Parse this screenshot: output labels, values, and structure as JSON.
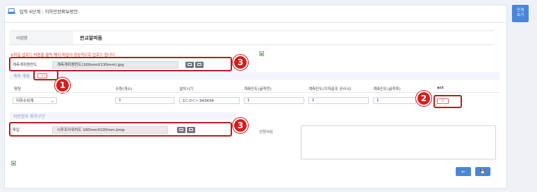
{
  "header": {
    "title": "입력 6단계 : 지하안전확보방안."
  },
  "side_button": {
    "label_line1": "단계",
    "label_line2": "보기"
  },
  "business": {
    "label": "사업명",
    "value": "판교알파돔"
  },
  "warning": "※파일 업로드 버튼을 클릭 해야 파일이 정상적으로 업로드 됩니다.",
  "plan_file": {
    "label": "계측계획평면도",
    "filename": "계측계획평면도(160mmX130mm).jpg"
  },
  "measure_section": {
    "title": "계측 계획",
    "add_label": "+"
  },
  "table": {
    "headers": [
      "명칭",
      "수량(개소)",
      "설치시기",
      "계측빈도(굴착전)",
      "계측빈도(지하골조 공사시)",
      "계측빈도(굴착후)",
      "act"
    ],
    "row": {
      "name": "지하수위계",
      "quantity": "1",
      "install_time": "1ㄷㄹㄷㄴ343434",
      "freq_before": "1",
      "freq_during": "1",
      "freq_after": "1",
      "delete_label": "X"
    }
  },
  "vuln_section": {
    "title": "지반침하 취약구간"
  },
  "vuln_file": {
    "label": "파일",
    "filename": "시추조사위치도 160mmX100mm.bmp"
  },
  "reason": {
    "label": "선정사유",
    "value": ""
  },
  "annotations": {
    "badge1": "1",
    "badge2": "2",
    "badge3a": "3",
    "badge3b": "3"
  },
  "footer": {
    "back_icon": "←",
    "save_icon": "💾"
  }
}
